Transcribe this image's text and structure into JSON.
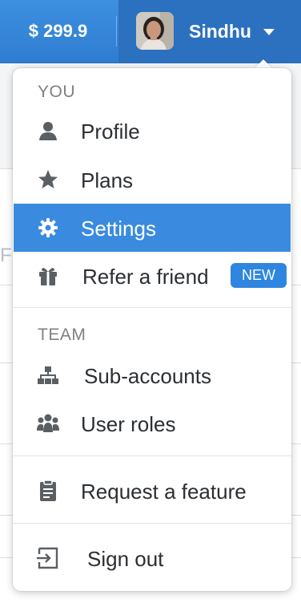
{
  "topbar": {
    "balance": "$ 299.9",
    "user_name": "Sindhu"
  },
  "menu": {
    "sections": [
      {
        "title": "YOU",
        "items": [
          {
            "label": "Profile",
            "icon": "user-icon"
          },
          {
            "label": "Plans",
            "icon": "star-icon"
          },
          {
            "label": "Settings",
            "icon": "gear-icon",
            "active": true
          },
          {
            "label": "Refer a friend",
            "icon": "gift-icon",
            "badge": "NEW"
          }
        ]
      },
      {
        "title": "TEAM",
        "items": [
          {
            "label": "Sub-accounts",
            "icon": "sitemap-icon"
          },
          {
            "label": "User roles",
            "icon": "users-icon"
          }
        ]
      }
    ],
    "extra_items": [
      {
        "label": "Request a feature",
        "icon": "clipboard-icon"
      },
      {
        "label": "Sign out",
        "icon": "sign-out-icon"
      }
    ]
  },
  "colors": {
    "topbar": "#3088dc",
    "active_item": "#3a8be0",
    "badge": "#2f86e0"
  }
}
